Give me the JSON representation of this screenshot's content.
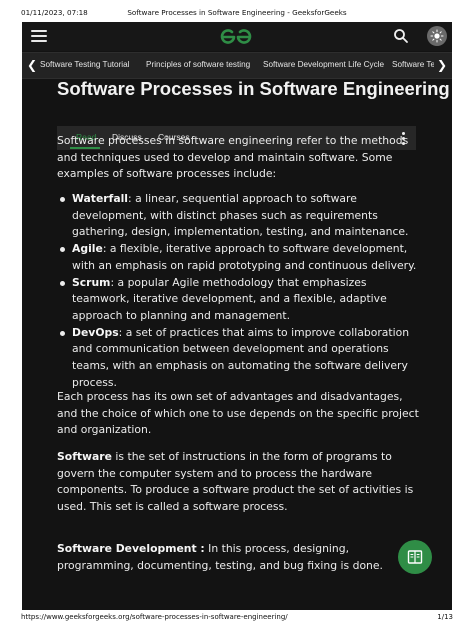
{
  "print": {
    "datetime": "01/11/2023, 07:18",
    "title": "Software Processes in Software Engineering - GeeksforGeeks",
    "url": "https://www.geeksforgeeks.org/software-processes-in-software-engineering/",
    "page": "1/13"
  },
  "header": {
    "logo_icon": "gfg-logo",
    "menu_icon": "hamburger-icon",
    "search_icon": "search-icon",
    "theme_icon": "sun-icon"
  },
  "tagbar": {
    "tags": [
      "Software Testing Tutorial",
      "Principles of software testing",
      "Software Development Life Cycle",
      "Software Testing Life Cycle"
    ]
  },
  "article": {
    "title": "Software Processes in Software Engineering",
    "tabs": [
      "Read",
      "Discuss",
      "Courses"
    ],
    "active_tab": "Read",
    "intro": "Software processes in software engineering refer to the methods and techniques used to develop and maintain software. Some examples of software processes include:",
    "list": [
      {
        "term": "Waterfall",
        "text": ": a linear, sequential approach to software development, with distinct phases such as requirements gathering, design, implementation, testing, and maintenance."
      },
      {
        "term": "Agile",
        "text": ": a flexible, iterative approach to software development, with an emphasis on rapid prototyping and continuous delivery."
      },
      {
        "term": "Scrum",
        "text": ": a popular Agile methodology that emphasizes teamwork, iterative development, and a flexible, adaptive approach to planning and management."
      },
      {
        "term": "DevOps",
        "text": ": a set of practices that aims to improve collaboration and communication between development and operations teams, with an emphasis on automating the software delivery process."
      }
    ],
    "para2": "Each process has its own set of advantages and disadvantages, and the choice of which one to use depends on the specific project and organization.",
    "para3_term": "Software",
    "para3": " is the set of instructions in the form of programs to govern the computer system and to process the hardware components. To produce a software product the set of activities is used. This set is called a software process.",
    "para4_term": "Software Development :",
    "para4": " In this process, designing, programming, documenting, testing, and bug fixing is done."
  },
  "colors": {
    "brand_green": "#2f8d46",
    "background": "#131313",
    "text": "#ececec"
  }
}
